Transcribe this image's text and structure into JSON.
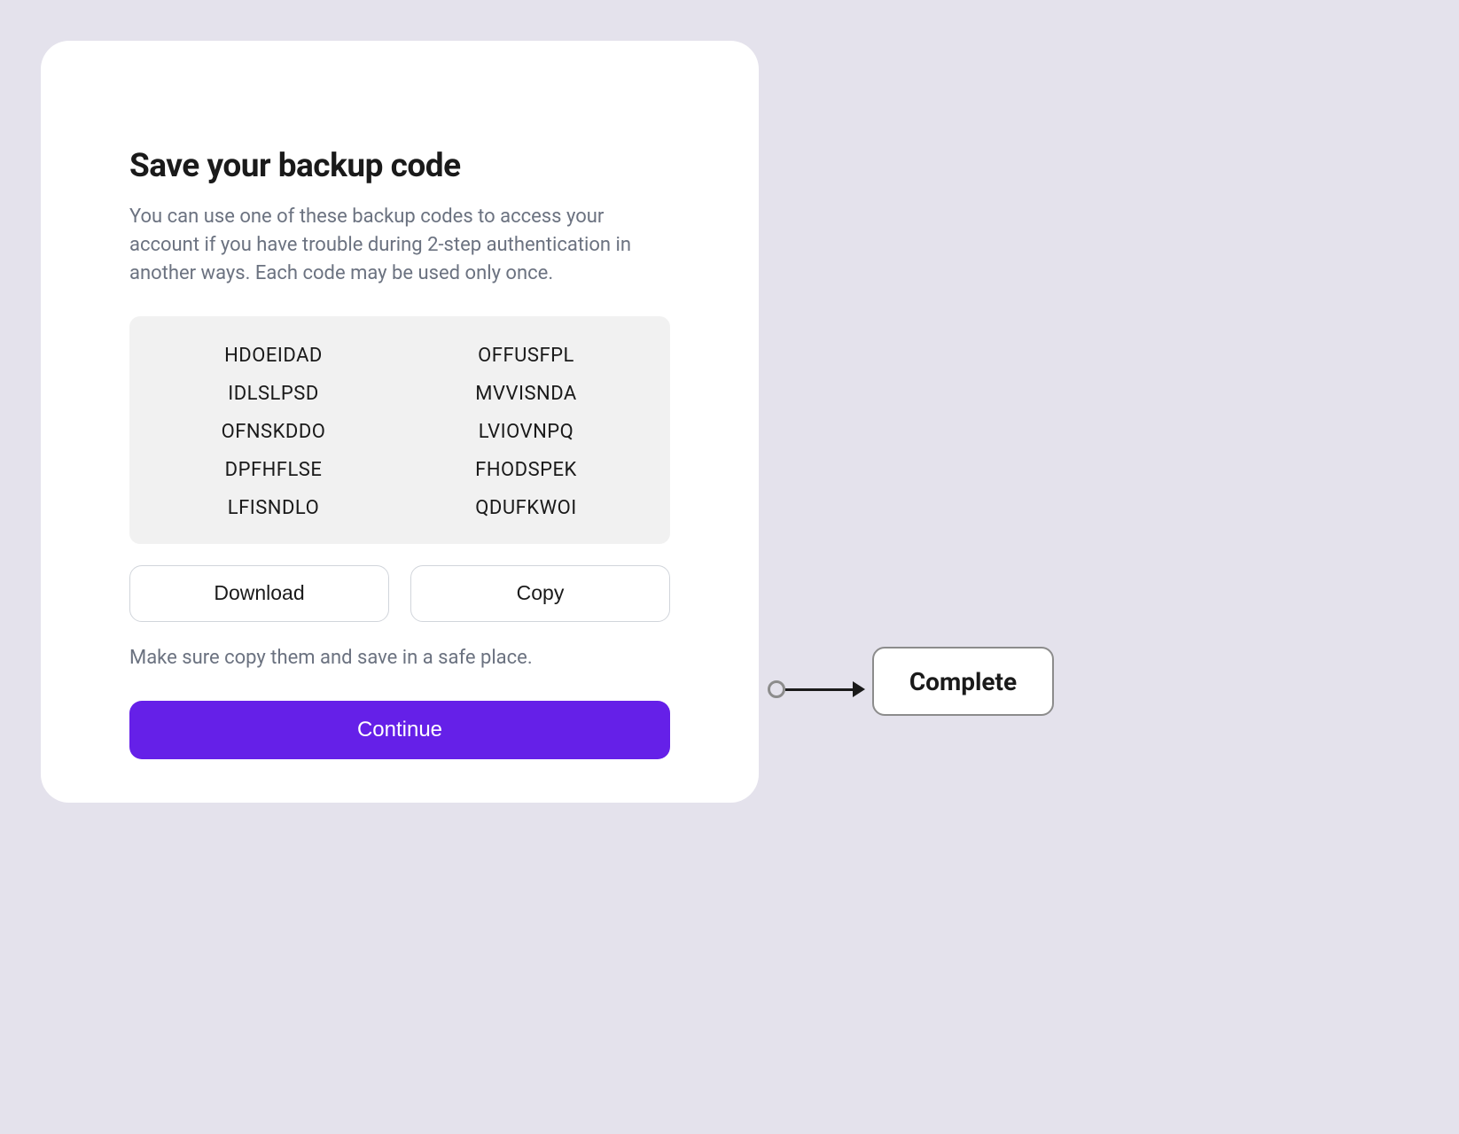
{
  "card": {
    "title": "Save your backup code",
    "description": "You can use one of these backup codes to access your account if you have trouble during 2-step authentication in another ways. Each code may be used only once.",
    "codes": {
      "left": [
        "HDOEIDAD",
        "IDLSLPSD",
        "OFNSKDDO",
        "DPFHFLSE",
        "LFISNDLO"
      ],
      "right": [
        "OFFUSFPL",
        "MVVISNDA",
        "LVIOVNPQ",
        "FHODSPEK",
        "QDUFKWOI"
      ]
    },
    "download_label": "Download",
    "copy_label": "Copy",
    "hint": "Make sure copy them and save in a safe place.",
    "continue_label": "Continue"
  },
  "annotation": {
    "complete_label": "Complete"
  }
}
